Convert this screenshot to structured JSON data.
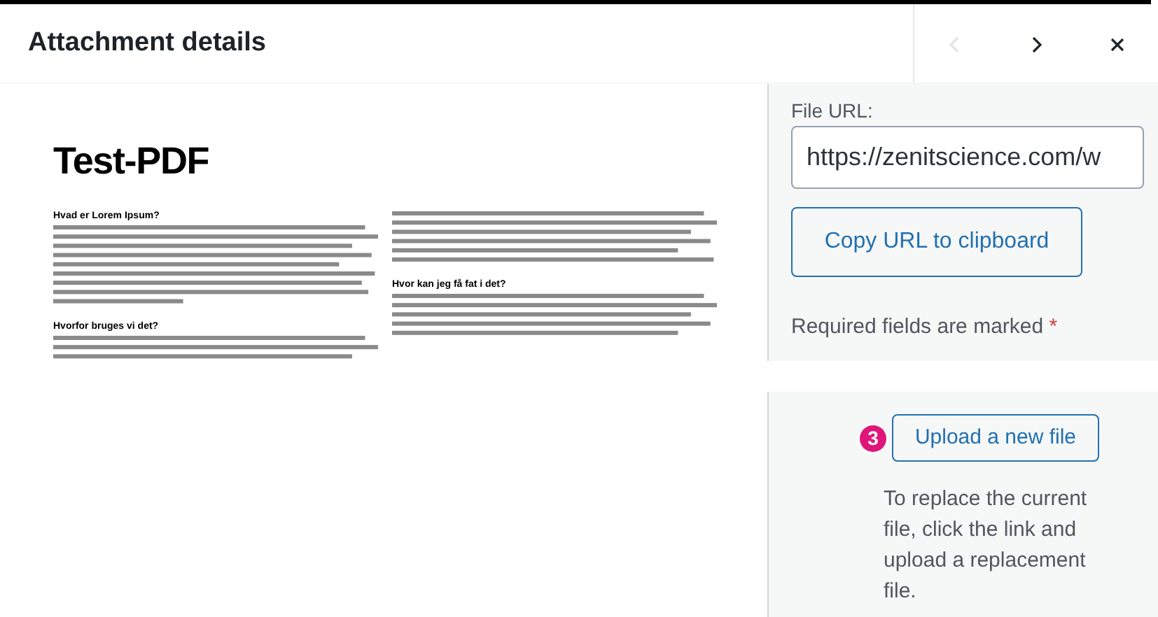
{
  "header": {
    "title": "Attachment details",
    "buttons": [
      {
        "kind": "previous",
        "disabled": true
      },
      {
        "kind": "next",
        "disabled": false
      },
      {
        "kind": "close",
        "disabled": false
      }
    ]
  },
  "preview": {
    "title": "Test-PDF",
    "columns": [
      {
        "sections": [
          {
            "heading": "Hvad er Lorem Ipsum?"
          },
          {
            "heading": "Hvorfor bruges vi det?"
          }
        ]
      },
      {
        "sections": [
          {
            "kind": "continued"
          },
          {
            "heading": "Hvor kan jeg få fat i det?"
          }
        ]
      }
    ]
  },
  "details": {
    "url_label": "File URL:",
    "url_value": "https://zenitscience.com/w",
    "copy_button": "Copy URL to clipboard",
    "required_note": "Required fields are marked",
    "required_mark": "*"
  },
  "replace": {
    "step": "3",
    "color": "#e0157a",
    "button": "Upload a new file",
    "description": "To replace the current file, click the link and upload a replacement file."
  }
}
